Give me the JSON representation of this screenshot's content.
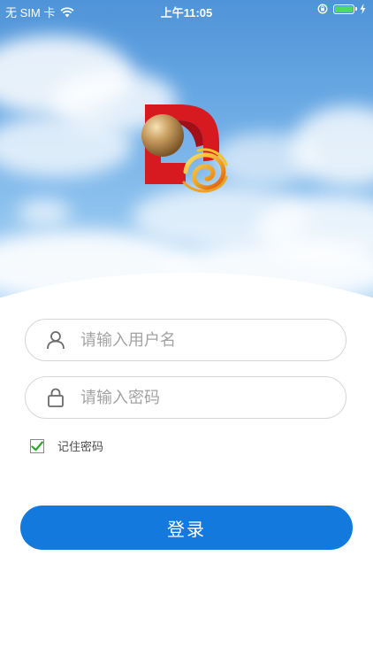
{
  "status_bar": {
    "carrier": "无 SIM 卡",
    "time": "上午11:05",
    "battery_level": 1.0
  },
  "login": {
    "username_placeholder": "请输入用户名",
    "password_placeholder": "请输入密码",
    "remember_label": "记住密码",
    "remember_checked": true,
    "submit_label": "登录"
  },
  "colors": {
    "primary": "#1479dd",
    "check": "#2aa52a",
    "logo_red": "#d71920",
    "logo_gold": "#e8a428"
  },
  "icons": [
    "wifi-icon",
    "orientation-lock-icon",
    "battery-icon",
    "charging-icon",
    "user-icon",
    "lock-icon",
    "check-icon",
    "app-logo"
  ]
}
